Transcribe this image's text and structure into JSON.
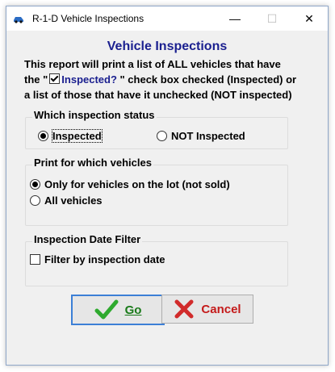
{
  "window": {
    "title": "R-1-D Vehicle Inspections",
    "minimize": "—",
    "maximize": "☐",
    "close": "✕"
  },
  "heading": "Vehicle Inspections",
  "description": {
    "line1": "This report will print a list of ALL vehicles that have",
    "line2_pre": "the \"",
    "line2_blue": "Inspected?",
    "line2_post": " \" check box checked (Inspected) or",
    "line3": "a list of those that have it unchecked (NOT inspected)"
  },
  "status_group": {
    "label": "Which inspection status",
    "options": [
      {
        "label": "Inspected",
        "selected": true
      },
      {
        "label": "NOT Inspected",
        "selected": false
      }
    ]
  },
  "vehicles_group": {
    "label": "Print for which vehicles",
    "options": [
      {
        "label": "Only for vehicles on the lot (not sold)",
        "selected": true
      },
      {
        "label": "All vehicles",
        "selected": false
      }
    ]
  },
  "date_group": {
    "label": "Inspection Date Filter",
    "checkbox_label": "Filter by inspection date",
    "checked": false
  },
  "buttons": {
    "go": "Go",
    "cancel": "Cancel"
  },
  "icons": {
    "app": "car-icon",
    "go": "checkmark-icon",
    "cancel": "x-icon"
  },
  "colors": {
    "heading": "#1a1f8f",
    "go_text": "#1a7a1a",
    "cancel_text": "#c41a1a",
    "focus_border": "#3c7fd6"
  }
}
